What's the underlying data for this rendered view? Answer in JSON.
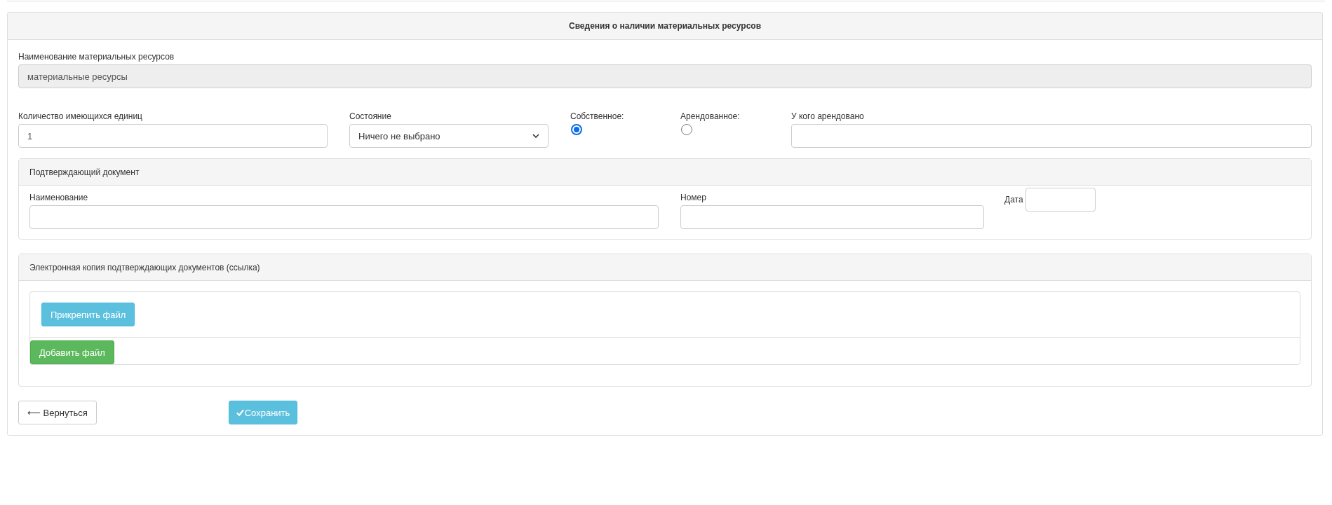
{
  "panel": {
    "title": "Сведения о наличии материальных ресурсов"
  },
  "resource_name": {
    "label": "Наименование материальных ресурсов",
    "value": "материальные ресурсы",
    "disabled": true
  },
  "quantity": {
    "label": "Количество имеющихся единиц",
    "value": "1"
  },
  "condition": {
    "label": "Состояние",
    "value": "Ничего не выбрано"
  },
  "ownership": [
    {
      "label": "Собственное:",
      "selected": true
    },
    {
      "label": "Арендованное:",
      "selected": false
    }
  ],
  "leased_from": {
    "label": "У кого арендовано"
  },
  "document": {
    "title": "Подтверждающий документ",
    "name_label": "Наименование",
    "number_label": "Номер",
    "date_label": "Дата"
  },
  "attachments": {
    "title": "Электронная копия подтверждающих документов (ссылка)",
    "attach_button": "Прикрепить файл",
    "add_button": "Добавить файл"
  },
  "actions": {
    "back": "⟵ Вернуться",
    "save": "Сохранить"
  }
}
